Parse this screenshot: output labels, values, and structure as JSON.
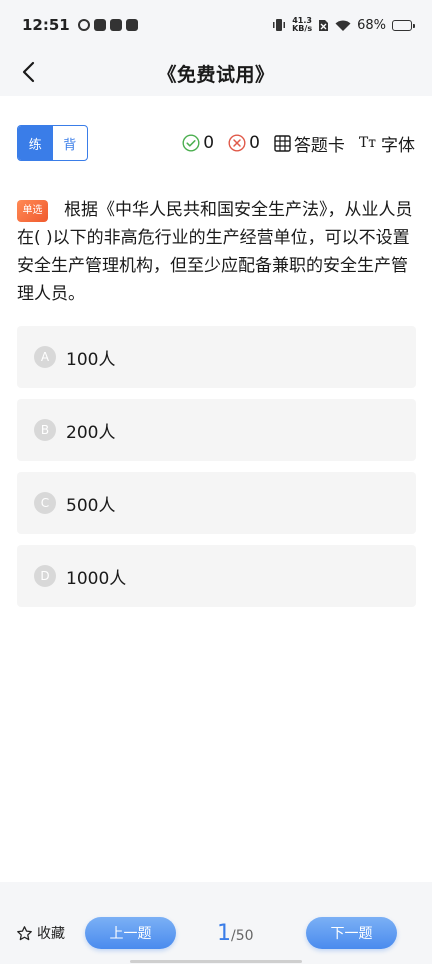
{
  "status_bar": {
    "time": "12:51",
    "net_speed_value": "41.3",
    "net_speed_unit": "KB/s",
    "battery": "68%",
    "battery_level": 0.68
  },
  "header": {
    "title": "《免费试用》"
  },
  "toolbar": {
    "mode_practice": "练",
    "mode_recite": "背",
    "correct_count": "0",
    "wrong_count": "0",
    "answer_card": "答题卡",
    "font_icon_text": "Tт",
    "font_label": "字体"
  },
  "question": {
    "badge": "单选",
    "text": "根据《中华人民共和国安全生产法》，从业人员在( )以下的非高危行业的生产经营单位，可以不设置安全生产管理机构，但至少应配备兼职的安全生产管理人员。"
  },
  "options": [
    {
      "letter": "A",
      "text": "100人"
    },
    {
      "letter": "B",
      "text": "200人"
    },
    {
      "letter": "C",
      "text": "500人"
    },
    {
      "letter": "D",
      "text": "1000人"
    }
  ],
  "bottom": {
    "favorite": "收藏",
    "prev": "上一题",
    "next": "下一题",
    "current_page": "1",
    "total_pages": "/50"
  },
  "colors": {
    "accent": "#3a7de8",
    "badge": "#f05a2e",
    "correct": "#4caf50",
    "wrong": "#e05a4a"
  }
}
